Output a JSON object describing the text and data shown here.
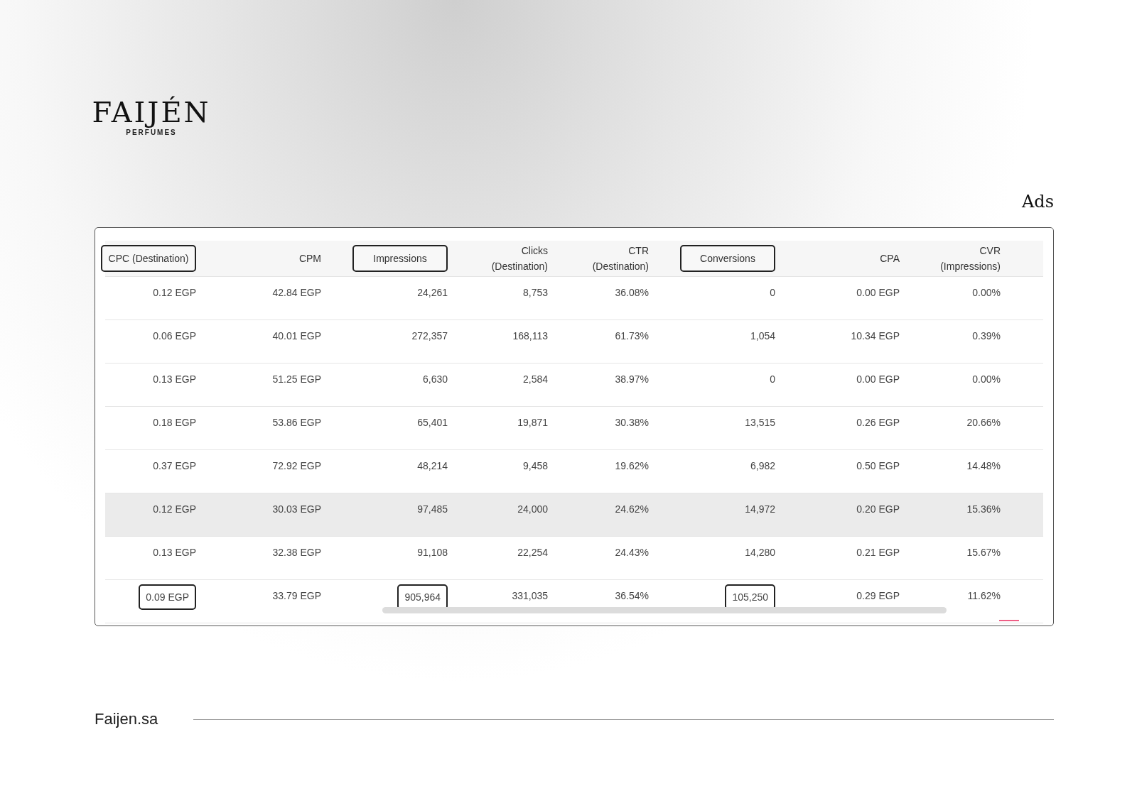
{
  "brand": {
    "name": "FAIJÉN",
    "tagline": "PERFUMES"
  },
  "section_title": "Ads",
  "table": {
    "columns": [
      {
        "label": "CPC (Destination)",
        "outlined": true
      },
      {
        "label": "CPM",
        "outlined": false
      },
      {
        "label": "Impressions",
        "outlined": true
      },
      {
        "label": "Clicks (Destination)",
        "outlined": false
      },
      {
        "label": "CTR (Destination)",
        "outlined": false
      },
      {
        "label": "Conversions",
        "outlined": true
      },
      {
        "label": "CPA",
        "outlined": false
      },
      {
        "label": "CVR (Impressions)",
        "outlined": false
      }
    ],
    "rows": [
      {
        "selected": false,
        "cells": [
          {
            "text": "0.12 EGP",
            "outlined": false
          },
          {
            "text": "42.84 EGP",
            "outlined": false
          },
          {
            "text": "24,261",
            "outlined": false
          },
          {
            "text": "8,753",
            "outlined": false
          },
          {
            "text": "36.08%",
            "outlined": false
          },
          {
            "text": "0",
            "outlined": false
          },
          {
            "text": "0.00 EGP",
            "outlined": false
          },
          {
            "text": "0.00%",
            "outlined": false
          }
        ]
      },
      {
        "selected": false,
        "cells": [
          {
            "text": "0.06 EGP",
            "outlined": false
          },
          {
            "text": "40.01 EGP",
            "outlined": false
          },
          {
            "text": "272,357",
            "outlined": false
          },
          {
            "text": "168,113",
            "outlined": false
          },
          {
            "text": "61.73%",
            "outlined": false
          },
          {
            "text": "1,054",
            "outlined": false
          },
          {
            "text": "10.34 EGP",
            "outlined": false
          },
          {
            "text": "0.39%",
            "outlined": false
          }
        ]
      },
      {
        "selected": false,
        "cells": [
          {
            "text": "0.13 EGP",
            "outlined": false
          },
          {
            "text": "51.25 EGP",
            "outlined": false
          },
          {
            "text": "6,630",
            "outlined": false
          },
          {
            "text": "2,584",
            "outlined": false
          },
          {
            "text": "38.97%",
            "outlined": false
          },
          {
            "text": "0",
            "outlined": false
          },
          {
            "text": "0.00 EGP",
            "outlined": false
          },
          {
            "text": "0.00%",
            "outlined": false
          }
        ]
      },
      {
        "selected": false,
        "cells": [
          {
            "text": "0.18 EGP",
            "outlined": false
          },
          {
            "text": "53.86 EGP",
            "outlined": false
          },
          {
            "text": "65,401",
            "outlined": false
          },
          {
            "text": "19,871",
            "outlined": false
          },
          {
            "text": "30.38%",
            "outlined": false
          },
          {
            "text": "13,515",
            "outlined": false
          },
          {
            "text": "0.26 EGP",
            "outlined": false
          },
          {
            "text": "20.66%",
            "outlined": false
          }
        ]
      },
      {
        "selected": false,
        "cells": [
          {
            "text": "0.37 EGP",
            "outlined": false
          },
          {
            "text": "72.92 EGP",
            "outlined": false
          },
          {
            "text": "48,214",
            "outlined": false
          },
          {
            "text": "9,458",
            "outlined": false
          },
          {
            "text": "19.62%",
            "outlined": false
          },
          {
            "text": "6,982",
            "outlined": false
          },
          {
            "text": "0.50 EGP",
            "outlined": false
          },
          {
            "text": "14.48%",
            "outlined": false
          }
        ]
      },
      {
        "selected": true,
        "cells": [
          {
            "text": "0.12 EGP",
            "outlined": false
          },
          {
            "text": "30.03 EGP",
            "outlined": false
          },
          {
            "text": "97,485",
            "outlined": false
          },
          {
            "text": "24,000",
            "outlined": false
          },
          {
            "text": "24.62%",
            "outlined": false
          },
          {
            "text": "14,972",
            "outlined": false
          },
          {
            "text": "0.20 EGP",
            "outlined": false
          },
          {
            "text": "15.36%",
            "outlined": false
          }
        ]
      },
      {
        "selected": false,
        "cells": [
          {
            "text": "0.13 EGP",
            "outlined": false
          },
          {
            "text": "32.38 EGP",
            "outlined": false
          },
          {
            "text": "91,108",
            "outlined": false
          },
          {
            "text": "22,254",
            "outlined": false
          },
          {
            "text": "24.43%",
            "outlined": false
          },
          {
            "text": "14,280",
            "outlined": false
          },
          {
            "text": "0.21 EGP",
            "outlined": false
          },
          {
            "text": "15.67%",
            "outlined": false
          }
        ]
      },
      {
        "selected": false,
        "cells": [
          {
            "text": "0.09 EGP",
            "outlined": true
          },
          {
            "text": "33.79 EGP",
            "outlined": false
          },
          {
            "text": "905,964",
            "outlined": true
          },
          {
            "text": "331,035",
            "outlined": false
          },
          {
            "text": "36.54%",
            "outlined": false
          },
          {
            "text": "105,250",
            "outlined": true
          },
          {
            "text": "0.29 EGP",
            "outlined": false
          },
          {
            "text": "11.62%",
            "outlined": false
          }
        ]
      }
    ]
  },
  "footer": {
    "website": "Faijen.sa"
  }
}
